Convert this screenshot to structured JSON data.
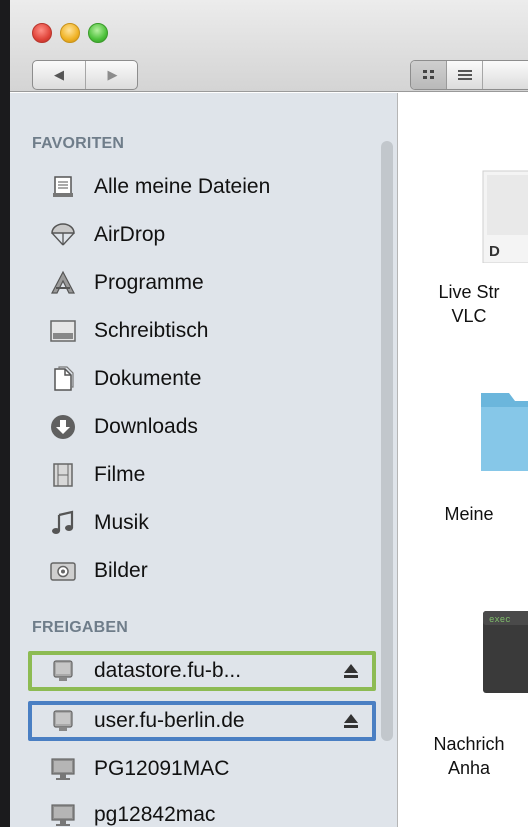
{
  "window": {
    "controls": [
      "close",
      "minimize",
      "maximize"
    ]
  },
  "toolbar": {
    "back_icon": "◀",
    "forward_icon": "▶"
  },
  "sidebar": {
    "favorites_title": "FAVORITEN",
    "favorites": [
      {
        "label": "Alle meine Dateien",
        "icon": "all-files-icon"
      },
      {
        "label": "AirDrop",
        "icon": "airdrop-icon"
      },
      {
        "label": "Programme",
        "icon": "applications-icon"
      },
      {
        "label": "Schreibtisch",
        "icon": "desktop-icon"
      },
      {
        "label": "Dokumente",
        "icon": "documents-icon"
      },
      {
        "label": "Downloads",
        "icon": "downloads-icon"
      },
      {
        "label": "Filme",
        "icon": "movies-icon"
      },
      {
        "label": "Musik",
        "icon": "music-icon"
      },
      {
        "label": "Bilder",
        "icon": "pictures-icon"
      }
    ],
    "shared_title": "FREIGABEN",
    "shared": [
      {
        "label": "datastore.fu-b...",
        "icon": "server-icon",
        "ejectable": true,
        "highlight": "#8dbb53"
      },
      {
        "label": "user.fu-berlin.de",
        "icon": "server-icon",
        "ejectable": true,
        "highlight": "#4a7fc3"
      },
      {
        "label": "PG12091MAC",
        "icon": "computer-icon",
        "ejectable": false
      },
      {
        "label": "pg12842mac",
        "icon": "computer-icon",
        "ejectable": false
      }
    ]
  },
  "content": {
    "files": [
      {
        "name_line1": "Live Str",
        "name_line2": "VLC",
        "icon": "document-icon",
        "icon_text": "D"
      },
      {
        "name_line1": "Meine",
        "name_line2": "",
        "icon": "folder-icon"
      },
      {
        "name_line1": "Nachrich",
        "name_line2": "Anha",
        "icon": "executable-icon",
        "icon_text": "exec"
      }
    ]
  }
}
